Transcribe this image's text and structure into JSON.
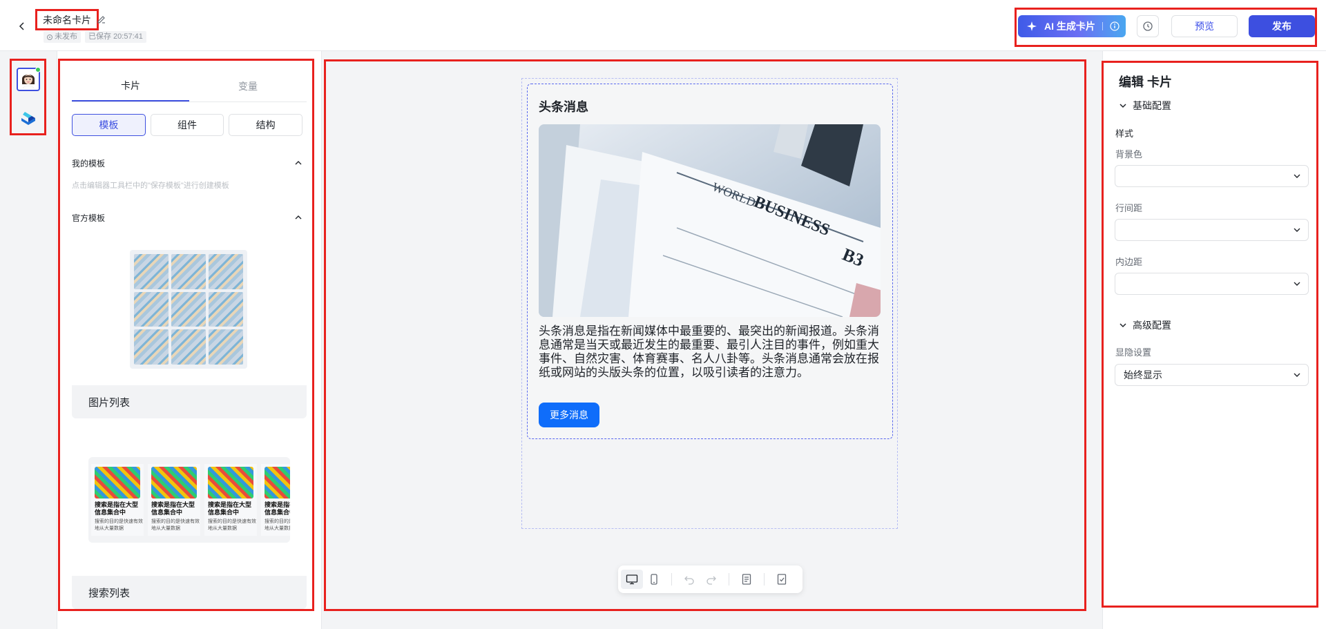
{
  "header": {
    "title": "未命名卡片",
    "status_unpublished": "未发布",
    "saved_text": "已保存 20:57:41",
    "ai_button_label": "AI 生成卡片",
    "preview_label": "预览",
    "publish_label": "发布"
  },
  "left_panel": {
    "tabs": [
      "卡片",
      "变量"
    ],
    "segments": [
      "模板",
      "组件",
      "结构"
    ],
    "my_templates_title": "我的模板",
    "my_templates_hint": "点击编辑器工具栏中的\"保存模板\"进行创建模板",
    "official_templates_title": "官方模板",
    "templates": [
      {
        "name": "图片列表"
      },
      {
        "name": "搜索列表"
      }
    ],
    "search_items": [
      {
        "title": "搜索是指在大型信息集合中",
        "desc": "搜索的目的是快速有效地从大量数据"
      },
      {
        "title": "搜索是指在大型信息集合中",
        "desc": "搜索的目的是快速有效地从大量数据"
      },
      {
        "title": "搜索是指在大型信息集合中",
        "desc": "搜索的目的是快速有效地从大量数据"
      },
      {
        "title": "搜索是指在大型信息集合中",
        "desc": "搜索的目的是快速有效地从大量数据"
      }
    ]
  },
  "canvas": {
    "card_title": "头条消息",
    "card_body": "头条消息是指在新闻媒体中最重要的、最突出的新闻报道。头条消息通常是当天或最近发生的最重要、最引人注目的事件，例如重大事件、自然灾害、体育赛事、名人八卦等。头条消息通常会放在报纸或网站的头版头条的位置，以吸引读者的注意力。",
    "more_button": "更多消息",
    "image_texts": {
      "world": "WORLD",
      "business": "BUSINESS",
      "code": "B3"
    }
  },
  "right_panel": {
    "title": "编辑 卡片",
    "basic_group": "基础配置",
    "style_label": "样式",
    "bg_color_label": "背景色",
    "line_height_label": "行间距",
    "padding_label": "内边距",
    "advanced_group": "高级配置",
    "visibility_label": "显隐设置",
    "visibility_value": "始终显示"
  },
  "colors": {
    "accent": "#3d4fe0",
    "primary_button": "#0f6dfa",
    "annotation_red": "#e8211e"
  }
}
